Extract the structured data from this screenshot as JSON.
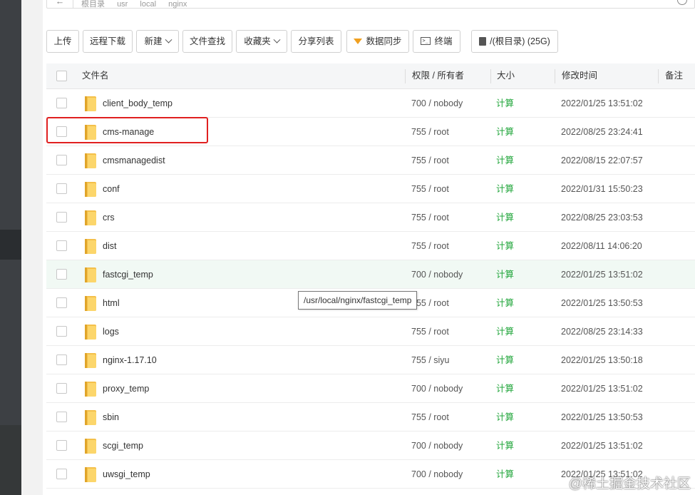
{
  "path": {
    "crumbs": [
      "根目录",
      "usr",
      "local",
      "nginx"
    ]
  },
  "toolbar": {
    "upload": "上传",
    "remote_download": "远程下载",
    "new": "新建",
    "find": "文件查找",
    "favorites": "收藏夹",
    "share_list": "分享列表",
    "sync": "数据同步",
    "terminal": "终端",
    "disk": "/(根目录) (25G)"
  },
  "table": {
    "headers": {
      "name": "文件名",
      "perm": "权限 / 所有者",
      "size": "大小",
      "mtime": "修改时间",
      "note": "备注"
    },
    "rows": [
      {
        "name": "client_body_temp",
        "perm": "700 / nobody",
        "size": "计算",
        "mtime": "2022/01/25 13:51:02"
      },
      {
        "name": "cms-manage",
        "perm": "755 / root",
        "size": "计算",
        "mtime": "2022/08/25 23:24:41"
      },
      {
        "name": "cmsmanagedist",
        "perm": "755 / root",
        "size": "计算",
        "mtime": "2022/08/15 22:07:57"
      },
      {
        "name": "conf",
        "perm": "755 / root",
        "size": "计算",
        "mtime": "2022/01/31 15:50:23"
      },
      {
        "name": "crs",
        "perm": "755 / root",
        "size": "计算",
        "mtime": "2022/08/25 23:03:53"
      },
      {
        "name": "dist",
        "perm": "755 / root",
        "size": "计算",
        "mtime": "2022/08/11 14:06:20"
      },
      {
        "name": "fastcgi_temp",
        "perm": "700 / nobody",
        "size": "计算",
        "mtime": "2022/01/25 13:51:02"
      },
      {
        "name": "html",
        "perm": "755 / root",
        "size": "计算",
        "mtime": "2022/01/25 13:50:53"
      },
      {
        "name": "logs",
        "perm": "755 / root",
        "size": "计算",
        "mtime": "2022/08/25 23:14:33"
      },
      {
        "name": "nginx-1.17.10",
        "perm": "755 / siyu",
        "size": "计算",
        "mtime": "2022/01/25 13:50:18"
      },
      {
        "name": "proxy_temp",
        "perm": "700 / nobody",
        "size": "计算",
        "mtime": "2022/01/25 13:51:02"
      },
      {
        "name": "sbin",
        "perm": "755 / root",
        "size": "计算",
        "mtime": "2022/01/25 13:50:53"
      },
      {
        "name": "scgi_temp",
        "perm": "700 / nobody",
        "size": "计算",
        "mtime": "2022/01/25 13:51:02"
      },
      {
        "name": "uwsgi_temp",
        "perm": "700 / nobody",
        "size": "计算",
        "mtime": "2022/01/25 13:51:02"
      }
    ]
  },
  "tooltip": "/usr/local/nginx/fastcgi_temp",
  "watermark": "@稀土掘金技术社区",
  "colors": {
    "accent_green": "#20a53a",
    "highlight_red": "#e02020",
    "sidebar": "#3d4044",
    "hover_row": "#f1f9f4"
  }
}
